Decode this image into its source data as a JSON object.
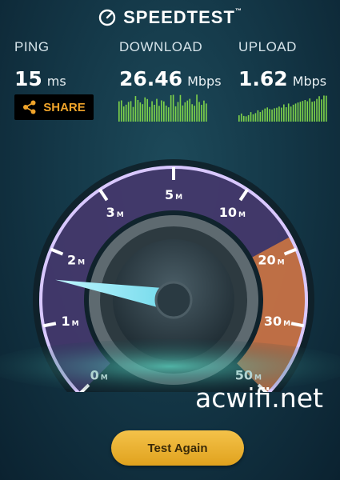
{
  "app": {
    "title": "SPEEDTEST",
    "trademark": "™"
  },
  "stats": {
    "ping": {
      "label": "PING",
      "value": "15",
      "unit": "ms"
    },
    "download": {
      "label": "DOWNLOAD",
      "value": "26.46",
      "unit": "Mbps"
    },
    "upload": {
      "label": "UPLOAD",
      "value": "1.62",
      "unit": "Mbps"
    }
  },
  "share": {
    "label": "SHARE",
    "icon": "share-icon"
  },
  "gauge": {
    "ticks": [
      {
        "num": "0",
        "unit": "M"
      },
      {
        "num": "1",
        "unit": "M"
      },
      {
        "num": "2",
        "unit": "M"
      },
      {
        "num": "3",
        "unit": "M"
      },
      {
        "num": "5",
        "unit": "M"
      },
      {
        "num": "10",
        "unit": "M"
      },
      {
        "num": "20",
        "unit": "M"
      },
      {
        "num": "30",
        "unit": "M"
      },
      {
        "num": "50",
        "unit": "M"
      }
    ],
    "needle_value_mbps": 1.62
  },
  "watermark": "acwifi.net",
  "actions": {
    "test_again": "Test Again"
  },
  "colors": {
    "accent_orange": "#f0a42a",
    "gauge_purple": "#9a6ae0",
    "gauge_orange": "#e8823a",
    "graph_green": "#7ed34a",
    "button_gold": "#ecb330"
  }
}
